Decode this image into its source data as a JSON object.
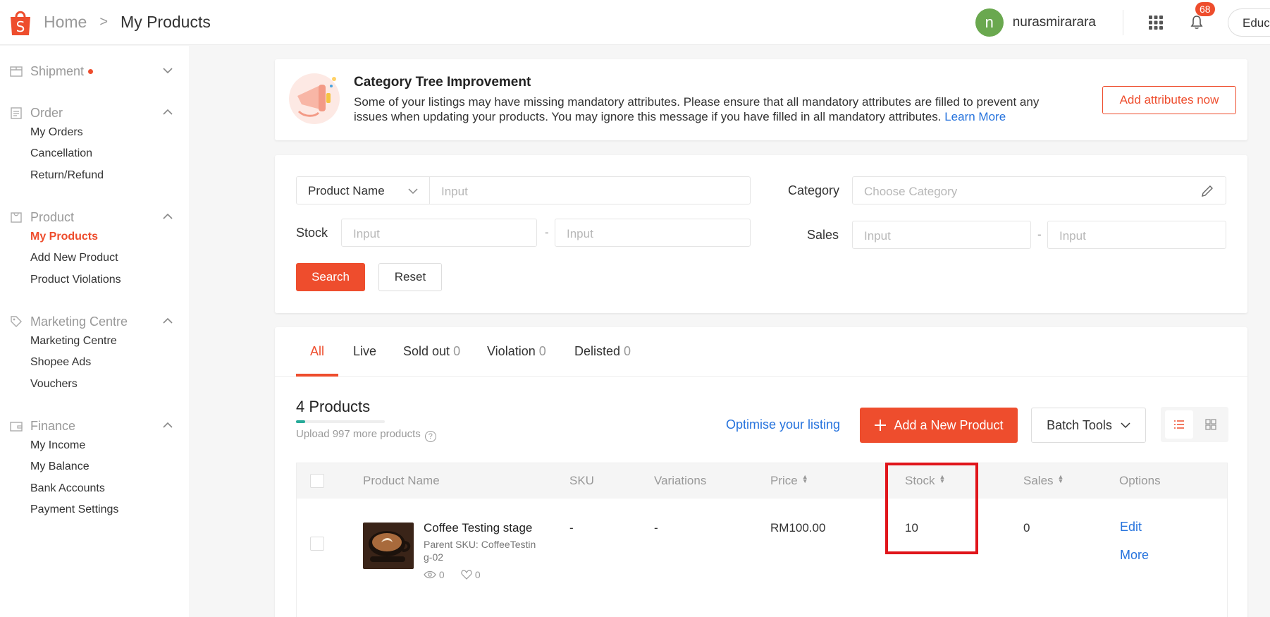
{
  "header": {
    "breadcrumb": {
      "home": "Home",
      "separator": ">",
      "current": "My Products"
    },
    "user": {
      "avatar_letter": "n",
      "name": "nurasmirarara"
    },
    "notifications_count": "68",
    "edu_label": "Educ"
  },
  "sidebar": {
    "shipment": {
      "title": "Shipment"
    },
    "order": {
      "title": "Order",
      "items": [
        "My Orders",
        "Cancellation",
        "Return/Refund"
      ]
    },
    "product": {
      "title": "Product",
      "items": [
        "My Products",
        "Add New Product",
        "Product Violations"
      ]
    },
    "marketing": {
      "title": "Marketing Centre",
      "items": [
        "Marketing Centre",
        "Shopee Ads",
        "Vouchers"
      ]
    },
    "finance": {
      "title": "Finance",
      "items": [
        "My Income",
        "My Balance",
        "Bank Accounts",
        "Payment Settings"
      ]
    }
  },
  "notice": {
    "title": "Category Tree Improvement",
    "text": "Some of your listings may have missing mandatory attributes. Please ensure that all mandatory attributes are filled to prevent any issues when updating your products. You may ignore this message if you have filled in all mandatory attributes.",
    "link": "Learn More",
    "button": "Add attributes now"
  },
  "filter": {
    "search_type": "Product Name",
    "input_placeholder": "Input",
    "category_label": "Category",
    "category_placeholder": "Choose Category",
    "stock_label": "Stock",
    "sales_label": "Sales",
    "range_separator": "-",
    "search_button": "Search",
    "reset_button": "Reset"
  },
  "tabs": [
    {
      "label": "All",
      "count": ""
    },
    {
      "label": "Live",
      "count": ""
    },
    {
      "label": "Sold out",
      "count": "0"
    },
    {
      "label": "Violation",
      "count": "0"
    },
    {
      "label": "Delisted",
      "count": "0"
    }
  ],
  "products": {
    "count_title": "4 Products",
    "upload_note": "Upload 997 more products",
    "upload_progress": 0.1,
    "optimise_link": "Optimise your listing",
    "add_button": "Add a New Product",
    "batch_tools": "Batch Tools"
  },
  "table": {
    "columns": [
      "Product Name",
      "SKU",
      "Variations",
      "Price",
      "Stock",
      "Sales",
      "Options"
    ],
    "rows": [
      {
        "name": "Coffee Testing stage",
        "parent_sku": "Parent SKU: CoffeeTesting-02",
        "views": "0",
        "likes": "0",
        "sku": "-",
        "variations": "-",
        "price": "RM100.00",
        "stock": "10",
        "sales": "0",
        "edit": "Edit",
        "more": "More"
      }
    ]
  },
  "colors": {
    "brand": "#ee4d2d",
    "link": "#2673dd",
    "highlight": "#e0151b"
  }
}
